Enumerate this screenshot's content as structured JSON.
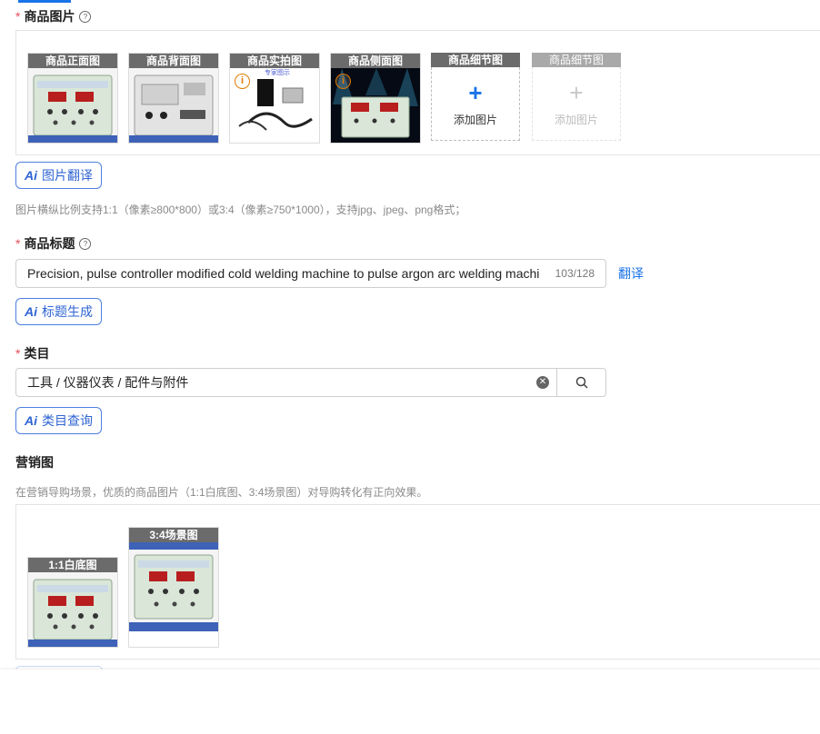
{
  "images_section": {
    "label": "商品图片",
    "help": "?",
    "slots": [
      {
        "caption": "商品正面图",
        "kind": "image",
        "variant": "front"
      },
      {
        "caption": "商品背面图",
        "kind": "image",
        "variant": "back"
      },
      {
        "caption": "商品实拍图",
        "kind": "image",
        "variant": "photo",
        "watermark": "专家图示"
      },
      {
        "caption": "商品侧面图",
        "kind": "image",
        "variant": "side"
      },
      {
        "caption": "商品细节图",
        "kind": "add",
        "add_text": "添加图片"
      },
      {
        "caption": "商品细节图",
        "kind": "add-disabled",
        "add_text": "添加图片"
      }
    ],
    "ai_button": "图片翻译",
    "hint": "图片横纵比例支持1:1（像素≥800*800）或3:4（像素≥750*1000），支持jpg、jpeg、png格式；"
  },
  "title_section": {
    "label": "商品标题",
    "help": "?",
    "value": "Precision, pulse controller modified cold welding machine to pulse argon arc welding machi",
    "counter": "103/128",
    "translate_link": "翻译",
    "ai_button": "标题生成"
  },
  "category_section": {
    "label": "类目",
    "value": "工具 / 仪器仪表 / 配件与附件",
    "ai_button": "类目查询"
  },
  "marketing_section": {
    "label": "营销图",
    "hint": "在营销导购场景，优质的商品图片（1:1白底图、3:4场景图）对导购转化有正向效果。",
    "items": [
      {
        "caption": "1:1白底图"
      },
      {
        "caption": "3:4场景图"
      }
    ]
  },
  "colors": {
    "accent": "#1a73e8",
    "required": "#e34d59",
    "ai": "#2f64d3"
  },
  "icons": [
    "help-icon",
    "ai-icon",
    "plus-icon",
    "info-icon",
    "clear-icon",
    "search-icon"
  ]
}
